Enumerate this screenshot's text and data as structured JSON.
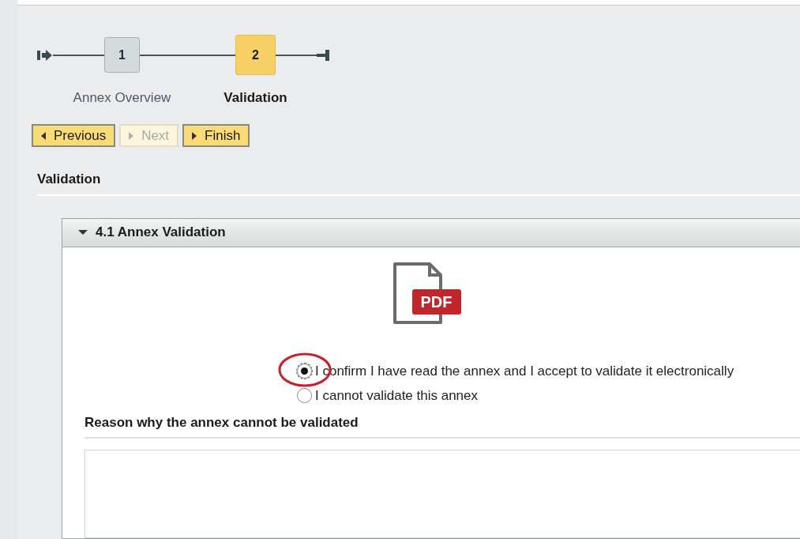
{
  "steps": [
    {
      "number": "1",
      "label": "Annex Overview",
      "selected": false
    },
    {
      "number": "2",
      "label": "Validation",
      "selected": true
    }
  ],
  "buttons": [
    {
      "label": "Previous",
      "kind": "back",
      "disabled": false
    },
    {
      "label": "Next",
      "kind": "forward",
      "disabled": true
    },
    {
      "label": "Finish",
      "kind": "forward",
      "disabled": false
    }
  ],
  "section_title": "Validation",
  "panel": {
    "title": "4.1 Annex Validation",
    "expanded": true,
    "file_badge": "PDF",
    "options": [
      {
        "label": "I confirm I have read the annex and I accept to validate it electronically",
        "selected": true
      },
      {
        "label": "I cannot validate this annex",
        "selected": false
      }
    ],
    "reason_label": "Reason why the annex cannot be validated"
  }
}
